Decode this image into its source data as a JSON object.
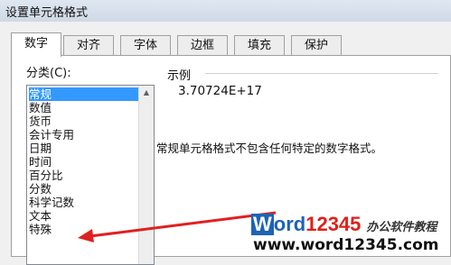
{
  "window": {
    "title": "设置单元格格式"
  },
  "tabs": [
    {
      "label": "数字",
      "active": true
    },
    {
      "label": "对齐",
      "active": false
    },
    {
      "label": "字体",
      "active": false
    },
    {
      "label": "边框",
      "active": false
    },
    {
      "label": "填充",
      "active": false
    },
    {
      "label": "保护",
      "active": false
    }
  ],
  "category": {
    "label": "分类(C):",
    "items": [
      "常规",
      "数值",
      "货币",
      "会计专用",
      "日期",
      "时间",
      "百分比",
      "分数",
      "科学记数",
      "文本",
      "特殊"
    ],
    "selected": "常规"
  },
  "sample": {
    "label": "示例",
    "value": "3.70724E+17"
  },
  "description": "常规单元格格式不包含任何特定的数字格式。",
  "annotation": {
    "arrow_color": "#e02020"
  },
  "watermark": {
    "brand_w": "W",
    "brand_rest": "ord",
    "brand_num": "12345",
    "tagline": "办公软件教程",
    "url": "www.word12345.com"
  }
}
